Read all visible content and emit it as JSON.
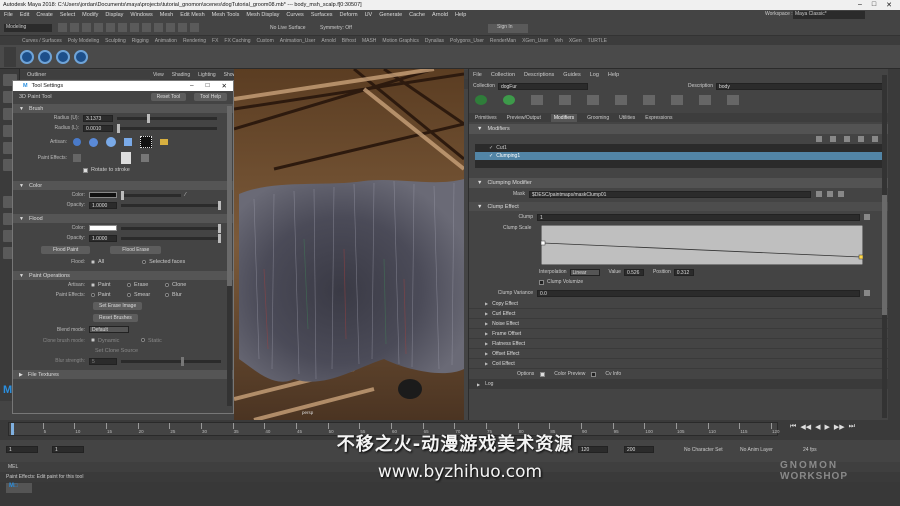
{
  "app": {
    "title": "Autodesk Maya 2018: C:\\Users\\jordan\\Documents\\maya\\projects\\tutorial_gnomon\\scenes\\dogTutorial_groom08.mb*  ---  body_msh_scalp.f[0:30507]",
    "workspace_label": "Workspace :",
    "workspace_value": "Maya Classic*"
  },
  "menubar": [
    "File",
    "Edit",
    "Create",
    "Select",
    "Modify",
    "Display",
    "Windows",
    "Mesh",
    "Edit Mesh",
    "Mesh Tools",
    "Mesh Display",
    "Curves",
    "Surfaces",
    "Deform",
    "UV",
    "Generate",
    "Cache",
    "Arnold",
    "Help"
  ],
  "statusline": {
    "mode": "Modeling",
    "live_surface": "No Live Surface",
    "symmetry": "Symmetry: Off",
    "sign_in": "Sign In"
  },
  "shelf_tabs": [
    "Curves / Surfaces",
    "Poly Modeling",
    "Sculpting",
    "Rigging",
    "Animation",
    "Rendering",
    "FX",
    "FX Caching",
    "Custom",
    "Animation_User",
    "Arnold",
    "Bifrost",
    "MASH",
    "Motion Graphics",
    "Dynalias",
    "Polygons_User",
    "RenderMan",
    "XGen_User",
    "Veh",
    "XGen",
    "TURTLE"
  ],
  "outliner": {
    "title": "Outliner"
  },
  "viewport": {
    "menu": [
      "View",
      "Shading",
      "Lighting",
      "Show",
      "Renderer",
      "Panels"
    ],
    "camera_label": "persp"
  },
  "tool_settings": {
    "window_title": "Tool Settings",
    "tool_name": "3D Paint Tool",
    "reset_tool": "Reset Tool",
    "tool_help": "Tool Help",
    "brush": {
      "title": "Brush",
      "radius_u_label": "Radius (U):",
      "radius_u": "3.1373",
      "radius_l_label": "Radius (L):",
      "radius_l": "0.0010",
      "artisan_label": "Artisan:",
      "paint_effects_label": "Paint Effects:",
      "rotate_to_stroke": "Rotate to stroke"
    },
    "color": {
      "title": "Color",
      "color_label": "Color:",
      "opacity_label": "Opacity:",
      "opacity": "1.0000"
    },
    "flood": {
      "title": "Flood",
      "color_label": "Color:",
      "opacity_label": "Opacity:",
      "opacity": "1.0000",
      "flood_paint": "Flood Paint",
      "flood_erase": "Flood Erase",
      "flood_label": "Flood:",
      "flood_all": "All",
      "flood_selected": "Selected faces"
    },
    "paint_ops": {
      "title": "Paint Operations",
      "artisan_label": "Artisan:",
      "paint_effects_label": "Paint Effects:",
      "artisan_opts": [
        "Paint",
        "Erase",
        "Clone"
      ],
      "pfx_opts": [
        "Paint",
        "Smear",
        "Blur"
      ],
      "set_erase_image": "Set Erase Image",
      "reset_brushes": "Reset Brushes",
      "blend_mode_label": "Blend mode:",
      "blend_mode": "Default",
      "clone_brush_mode_label": "Clone brush mode:",
      "clone_opts": [
        "Dynamic",
        "Static"
      ],
      "set_clone_source": "Set Clone Source",
      "blur_strength_label": "Blur strength:",
      "blur_strength": "5"
    },
    "file_textures": {
      "title": "File Textures"
    }
  },
  "xgen": {
    "menu": [
      "File",
      "Collection",
      "Descriptions",
      "Guides",
      "Log",
      "Help"
    ],
    "collection_label": "Collection",
    "collection": "dogFur",
    "description_label": "Description",
    "description": "body",
    "tabs": [
      "Primitives",
      "Preview/Output",
      "Modifiers",
      "Grooming",
      "Utilities",
      "Expressions"
    ],
    "active_tab": "Modifiers",
    "modifiers_header": "Modifiers",
    "modifier_list": [
      "Cut1",
      "Clumping1"
    ],
    "clumping_header": "Clumping Modifier",
    "mask_label": "Mask",
    "mask_value": "$DESC/paintmaps/maskClump01",
    "clump_effect_header": "Clump Effect",
    "clump_label": "Clump",
    "clump_value": "1",
    "clump_scale_label": "Clump Scale",
    "interp_label": "Interpolation",
    "interp_value": "Linear",
    "value_label": "Value",
    "value_value": "0.526",
    "position_label": "Position",
    "position_value": "0.312",
    "clump_volumize": "Clump Volumize",
    "clump_variance_label": "Clump Variance",
    "clump_variance": "0.0",
    "collapsed_sections": [
      "Copy Effect",
      "Curl Effect",
      "Noise Effect",
      "Frame Offset",
      "Flatness Effect",
      "Offset Effect",
      "Coil Effect"
    ],
    "bottom_row": [
      "Options",
      "Color Preview",
      "Cv Info"
    ],
    "log": "Log"
  },
  "timeline": {
    "ticks": [
      "1",
      "5",
      "10",
      "15",
      "20",
      "25",
      "30",
      "35",
      "40",
      "45",
      "50",
      "55",
      "60",
      "65",
      "70",
      "75",
      "80",
      "85",
      "90",
      "95",
      "100",
      "105",
      "110",
      "115",
      "120"
    ],
    "start": "1",
    "current": "1",
    "end_a": "120",
    "end_b": "200",
    "character_set": "No Character Set",
    "anim_layer": "No Anim Layer",
    "fps": "24 fps"
  },
  "mel": "MEL",
  "help_line": "Paint Effects: Edit paint for this tool",
  "overlay": {
    "subtitle": "不移之火-动漫游戏美术资源",
    "watermark": "www.byzhihuo.com",
    "brand_top": "GNOMON",
    "brand_bottom": "WORKSHOP"
  }
}
